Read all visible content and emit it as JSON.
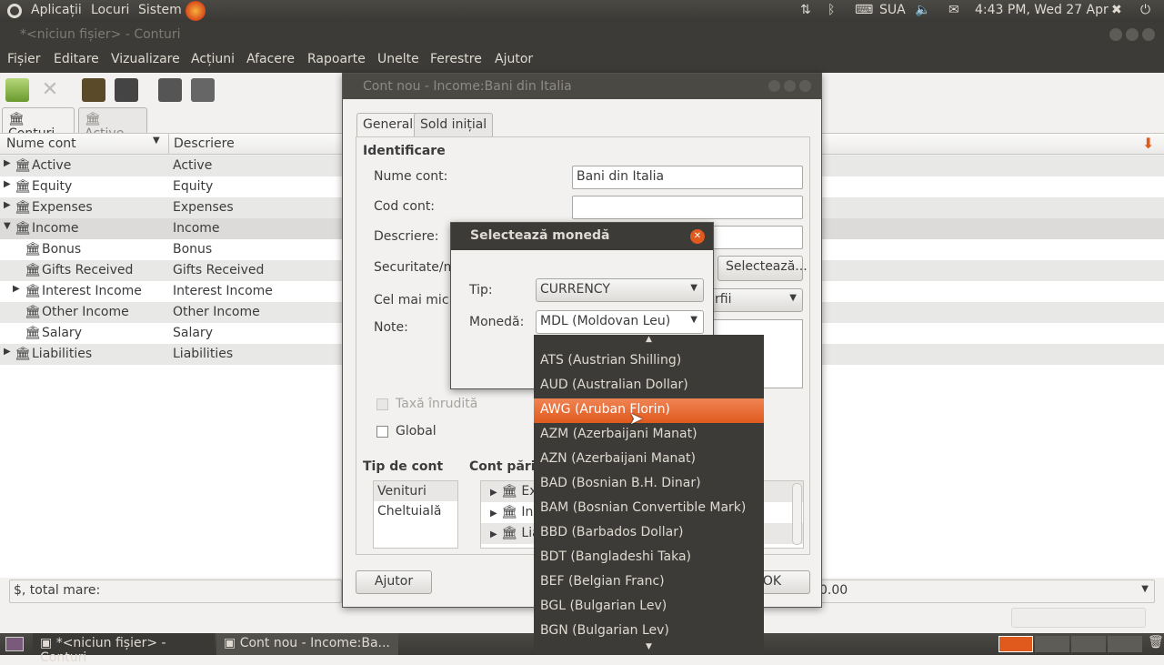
{
  "topbar": {
    "apps": "Aplicații",
    "places": "Locuri",
    "system": "Sistem",
    "keyboard": "SUA",
    "datetime": "4:43 PM, Wed 27 Apr"
  },
  "window": {
    "title": "*<niciun fișier> - Conturi"
  },
  "menu": [
    "Fișier",
    "Editare",
    "Vizualizare",
    "Acțiuni",
    "Afacere",
    "Rapoarte",
    "Unelte",
    "Ferestre",
    "Ajutor"
  ],
  "tabs": [
    "Conturi",
    "Active"
  ],
  "columns": {
    "name": "Nume cont",
    "desc": "Descriere"
  },
  "accounts": [
    {
      "name": "Active",
      "desc": "Active"
    },
    {
      "name": "Equity",
      "desc": "Equity"
    },
    {
      "name": "Expenses",
      "desc": "Expenses"
    },
    {
      "name": "Income",
      "desc": "Income"
    },
    {
      "name": "Bonus",
      "desc": "Bonus"
    },
    {
      "name": "Gifts Received",
      "desc": "Gifts Received"
    },
    {
      "name": "Interest Income",
      "desc": "Interest Income"
    },
    {
      "name": "Other Income",
      "desc": "Other Income"
    },
    {
      "name": "Salary",
      "desc": "Salary"
    },
    {
      "name": "Liabilities",
      "desc": "Liabilities"
    }
  ],
  "status": {
    "total": "$, total mare:",
    "right_value": "0.00"
  },
  "taskbar": [
    "*<niciun fișier> - Conturi",
    "Cont nou - Income:Ba..."
  ],
  "dialog": {
    "title": "Cont nou - Income:Bani din Italia",
    "tabs": [
      "General",
      "Sold inițial"
    ],
    "section": "Identificare",
    "name_label": "Nume cont:",
    "name_value": "Bani din Italia",
    "code_label": "Cod cont:",
    "desc_label": "Descriere:",
    "sec_label": "Securitate/m",
    "select_btn": "Selectează...",
    "min_label": "Cel mai mic r",
    "combo_partial": "rfii",
    "notes_label": "Note:",
    "tax_label": "Taxă înrudită",
    "global_label": "Global",
    "type_label": "Tip de cont",
    "parent_label": "Cont părin",
    "types": [
      "Venituri",
      "Cheltuială"
    ],
    "parents": [
      "Ex",
      "Inc",
      "Lia"
    ],
    "help_btn": "Ajutor",
    "ok_btn": "OK"
  },
  "select": {
    "title": "Selectează monedă",
    "type_label": "Tip:",
    "type_value": "CURRENCY",
    "currency_label": "Monedă:",
    "currency_value": "MDL (Moldovan Leu)"
  },
  "currencies": [
    "ATS (Austrian Shilling)",
    "AUD (Australian Dollar)",
    "AWG (Aruban Florin)",
    "AZM (Azerbaijani Manat)",
    "AZN (Azerbaijani Manat)",
    "BAD (Bosnian B.H. Dinar)",
    "BAM (Bosnian Convertible Mark)",
    "BBD (Barbados Dollar)",
    "BDT (Bangladeshi Taka)",
    "BEF (Belgian Franc)",
    "BGL (Bulgarian Lev)",
    "BGN (Bulgarian Lev)"
  ],
  "colors": {
    "accent": "#e05a1e",
    "panel": "#3c3b37"
  }
}
